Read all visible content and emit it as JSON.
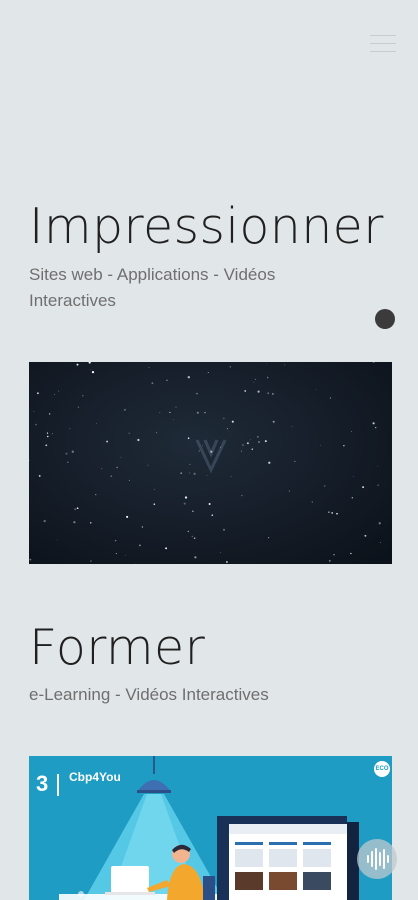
{
  "header": {
    "menu_icon": "hamburger-menu-icon"
  },
  "sections": [
    {
      "title": "Impressionner",
      "subtitle": "Sites web - Applications - Vidéos Interactives",
      "media": {
        "type": "video",
        "logo_icon": "brand-logo-icon"
      }
    },
    {
      "title": "Former",
      "subtitle": "e-Learning - Vidéos Interactives",
      "media": {
        "type": "illustration",
        "number": "3",
        "brand": "Cbp4You",
        "badge": "ECO"
      }
    }
  ],
  "floating": {
    "audio_icon": "sound-wave-icon"
  },
  "colors": {
    "background": "#e1e6e8",
    "promo": "#1f9cc4",
    "dot": "#3b3b3b"
  }
}
